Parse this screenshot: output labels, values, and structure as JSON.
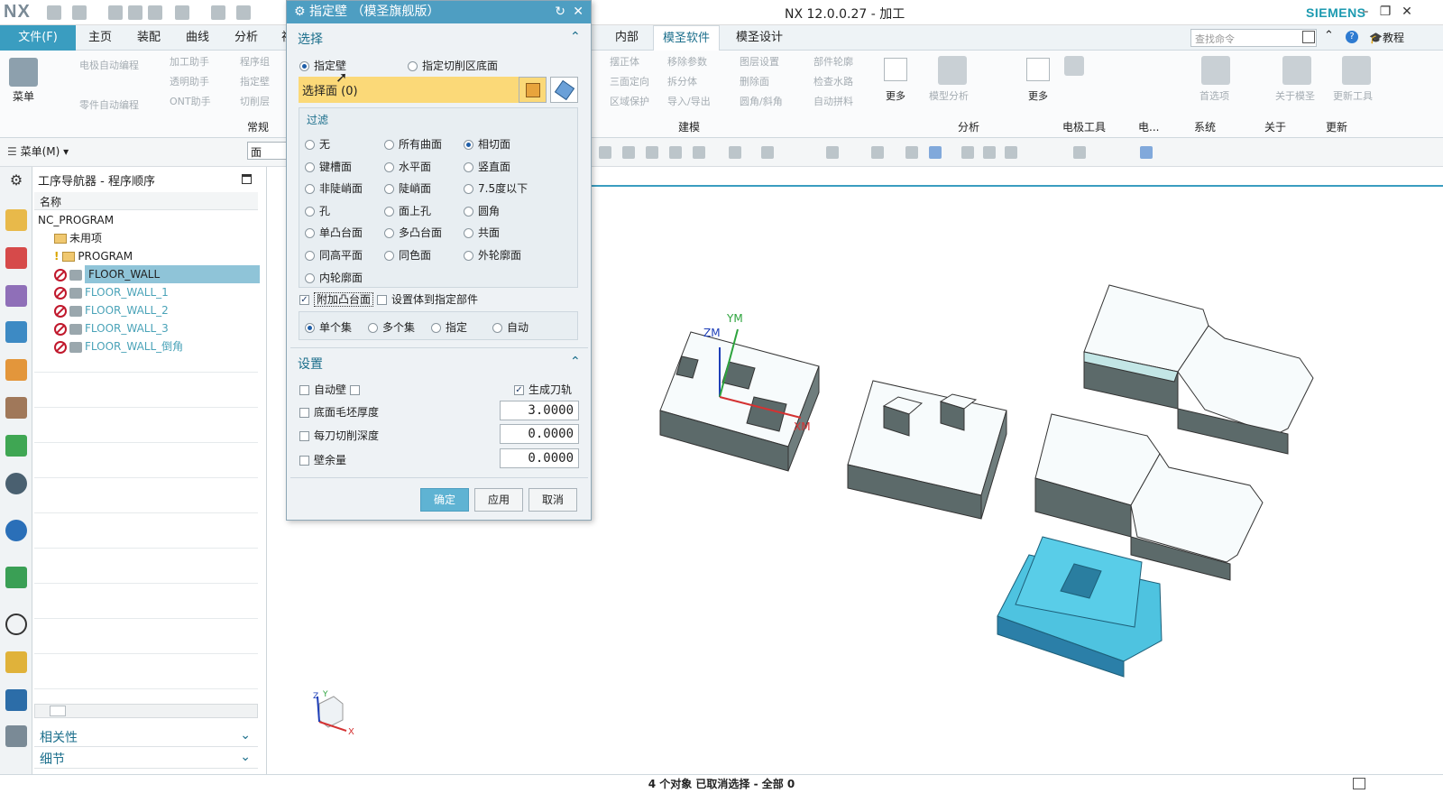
{
  "app": {
    "logo": "NX",
    "window_title": "NX 12.0.0.27 - 加工",
    "brand": "SIEMENS"
  },
  "menubar": {
    "file": "文件(F)",
    "tabs": [
      "主页",
      "装配",
      "曲线",
      "分析",
      "视",
      "内部",
      "模圣软件",
      "模圣设计"
    ],
    "active_tab": "模圣软件",
    "search_placeholder": "查找命令",
    "help_label": "教程"
  },
  "ribbon": {
    "menu_button": "菜单",
    "left_col1": [
      "电极自动编程",
      "零件自动编程"
    ],
    "left_col2": [
      "加工助手",
      "透明助手",
      "ONT助手"
    ],
    "left_col3": [
      "程序组",
      "指定壁",
      "切削层"
    ],
    "group_common": "常规",
    "right_col1": [
      "摆正体",
      "三面定向",
      "区域保护"
    ],
    "right_col2": [
      "移除参数",
      "拆分体",
      "导入/导出"
    ],
    "right_col3": [
      "图层设置",
      "删除面",
      "圆角/斜角"
    ],
    "right_col4": [
      "部件轮廓",
      "检查水路",
      "自动拼料"
    ],
    "more_label": "更多",
    "model_analysis": "模型分析",
    "preferences": "首选项",
    "about_mosheng": "关于模圣",
    "update_tools": "更新工具",
    "groups": [
      "建模",
      "分析",
      "电极工具",
      "电...",
      "系统",
      "关于",
      "更新"
    ]
  },
  "toolbar2": {
    "menu_label": "菜单(M)",
    "filter_value": "面"
  },
  "navigator": {
    "title": "工序导航器 - 程序顺序",
    "column": "名称",
    "root": "NC_PROGRAM",
    "unused": "未用项",
    "program": "PROGRAM",
    "ops": [
      "FLOOR_WALL",
      "FLOOR_WALL_1",
      "FLOOR_WALL_2",
      "FLOOR_WALL_3",
      "FLOOR_WALL_倒角"
    ],
    "related": "相关性",
    "details": "细节"
  },
  "dialog": {
    "title": "指定壁 （模圣旗舰版）",
    "select_section": "选择",
    "mode_wall": "指定壁",
    "mode_floor": "指定切削区底面",
    "select_faces": "选择面 (0)",
    "filter_title": "过滤",
    "filters": [
      [
        "无",
        "所有曲面",
        "相切面"
      ],
      [
        "键槽面",
        "水平面",
        "竖直面"
      ],
      [
        "非陡峭面",
        "陡峭面",
        "7.5度以下"
      ],
      [
        "孔",
        "面上孔",
        "圆角"
      ],
      [
        "单凸台面",
        "多凸台面",
        "共面"
      ],
      [
        "同高平面",
        "同色面",
        "外轮廓面"
      ],
      [
        "内轮廓面"
      ]
    ],
    "filter_selected": "相切面",
    "add_boss": "附加凸台面",
    "set_body": "设置体到指定部件",
    "sets": [
      "单个集",
      "多个集",
      "指定",
      "自动"
    ],
    "set_selected": "单个集",
    "settings_section": "设置",
    "auto_wall": "自动壁",
    "gen_path": "生成刀轨",
    "floor_stock": "底面毛坯厚度",
    "floor_stock_val": "3.0000",
    "depth_per_cut": "每刀切削深度",
    "depth_val": "0.0000",
    "wall_stock": "壁余量",
    "wall_val": "0.0000",
    "ok": "确定",
    "apply": "应用",
    "cancel": "取消"
  },
  "viewport": {
    "axis_zm": "ZM",
    "axis_ym": "YM",
    "axis_xm": "XM",
    "triad_x": "X",
    "triad_y": "Y",
    "triad_z": "Z"
  },
  "status": {
    "text": "4 个对象 已取消选择 - 全部 0"
  }
}
